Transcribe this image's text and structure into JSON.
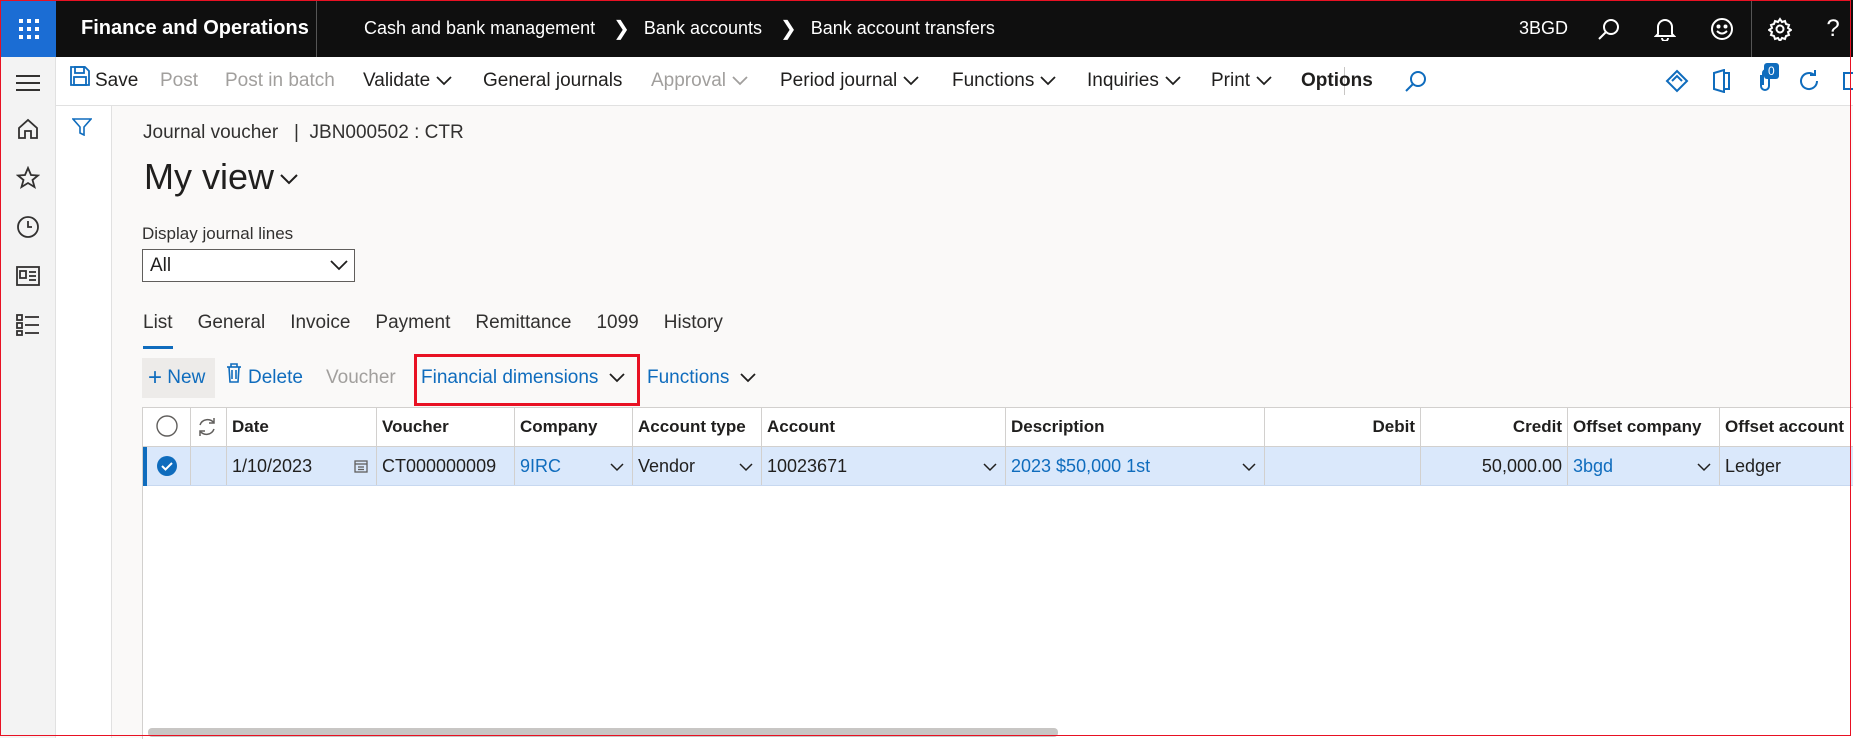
{
  "app": {
    "title": "Finance and Operations",
    "company": "3BGD"
  },
  "breadcrumb": [
    "Cash and bank management",
    "Bank accounts",
    "Bank account transfers"
  ],
  "actions": {
    "save": "Save",
    "post": "Post",
    "post_in_batch": "Post in batch",
    "validate": "Validate",
    "general_journals": "General journals",
    "approval": "Approval",
    "period_journal": "Period journal",
    "functions": "Functions",
    "inquiries": "Inquiries",
    "print": "Print",
    "options": "Options",
    "badge_count": "0"
  },
  "page": {
    "caption": "Journal voucher   |  JBN000502 : CTR",
    "view_title": "My view",
    "display_label": "Display journal lines",
    "display_value": "All"
  },
  "tabs": [
    "List",
    "General",
    "Invoice",
    "Payment",
    "Remittance",
    "1099",
    "History"
  ],
  "grid_actions": {
    "new": "New",
    "delete": "Delete",
    "voucher": "Voucher",
    "financial_dimensions": "Financial dimensions",
    "functions": "Functions"
  },
  "grid": {
    "columns": [
      "Date",
      "Voucher",
      "Company",
      "Account type",
      "Account",
      "Description",
      "Debit",
      "Credit",
      "Offset company",
      "Offset account"
    ],
    "rows": [
      {
        "date": "1/10/2023",
        "voucher": "CT000000009",
        "company": "9IRC",
        "account_type": "Vendor",
        "account": "10023671",
        "description": "2023 $50,000 1st",
        "debit": "",
        "credit": "50,000.00",
        "offset_company": "3bgd",
        "offset_account": "Ledger"
      }
    ]
  },
  "colors": {
    "accent": "#0f6cbd",
    "topbar": "#0f0f0f",
    "waffle": "#1b6dd4",
    "highlight": "#e81123",
    "selected_row": "#dae8fb"
  },
  "icons": [
    "waffle-icon",
    "search-icon",
    "bell-icon",
    "smiley-icon",
    "gear-icon",
    "help-icon",
    "hamburger-icon",
    "home-icon",
    "star-icon",
    "clock-icon",
    "workspace-icon",
    "modules-icon",
    "save-icon",
    "filter-icon",
    "refresh-icon",
    "calendar-icon",
    "delete-icon",
    "plus-icon"
  ]
}
